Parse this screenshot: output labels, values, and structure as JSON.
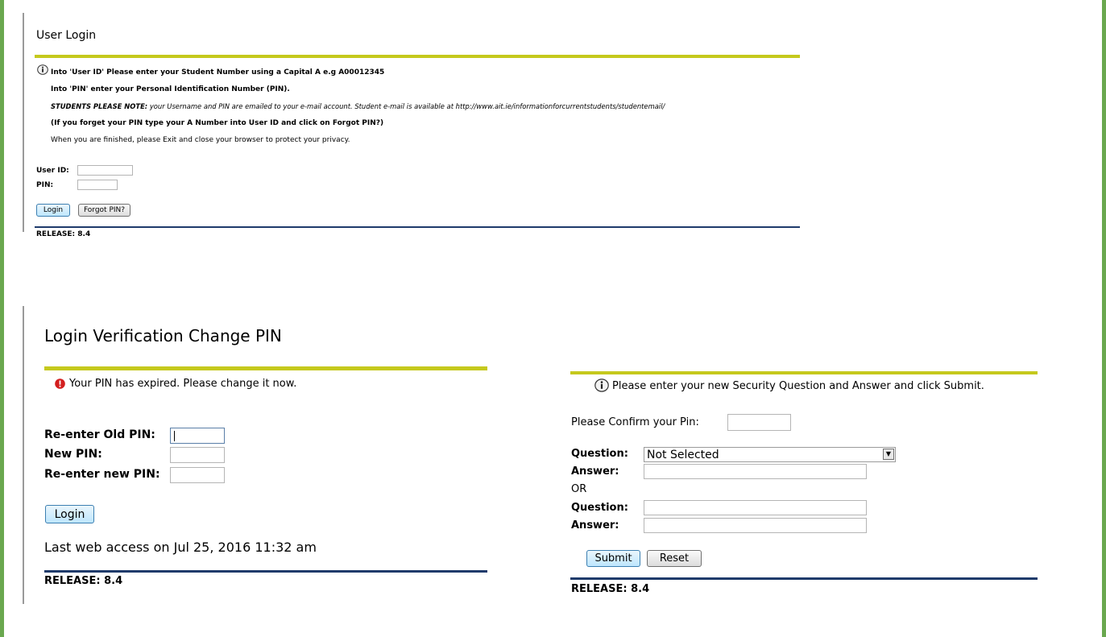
{
  "user_login": {
    "title": "User Login",
    "info": [
      "Into 'User ID' Please enter your Student Number using a Capital A e.g A00012345",
      "Into 'PIN' enter your Personal Identification Number (PIN).",
      "(If you forget your PIN type your A Number into User ID and click on Forgot PIN?)",
      "When you are finished, please Exit and close your browser to protect your privacy."
    ],
    "note_label": "STUDENTS PLEASE NOTE:",
    "note_text": " your Username and PIN are emailed to your e-mail account. Student e-mail is available at http://www.ait.ie/informationforcurrentstudents/studentemail/",
    "user_id_label": "User ID:",
    "user_id_value": "",
    "pin_label": "PIN:",
    "pin_value": "",
    "login_button": "Login",
    "forgot_button": "Forgot PIN?",
    "release": "RELEASE: 8.4"
  },
  "change_pin": {
    "title": "Login Verification Change PIN",
    "error_message": "Your PIN has expired. Please change it now.",
    "old_pin_label": "Re-enter Old PIN:",
    "new_pin_label": "New PIN:",
    "reenter_new_pin_label": "Re-enter new PIN:",
    "login_button": "Login",
    "last_access": "Last web access on Jul 25, 2016 11:32 am",
    "release": "RELEASE: 8.4"
  },
  "security": {
    "info_message": "Please enter your new Security Question and Answer and click Submit.",
    "confirm_pin_label": "Please Confirm your Pin:",
    "question_label": "Question:",
    "question_selected": "Not Selected",
    "answer_label": "Answer:",
    "or_label": "OR",
    "question2_label": "Question:",
    "answer2_label": "Answer:",
    "submit_button": "Submit",
    "reset_button": "Reset",
    "release": "RELEASE: 8.4"
  }
}
